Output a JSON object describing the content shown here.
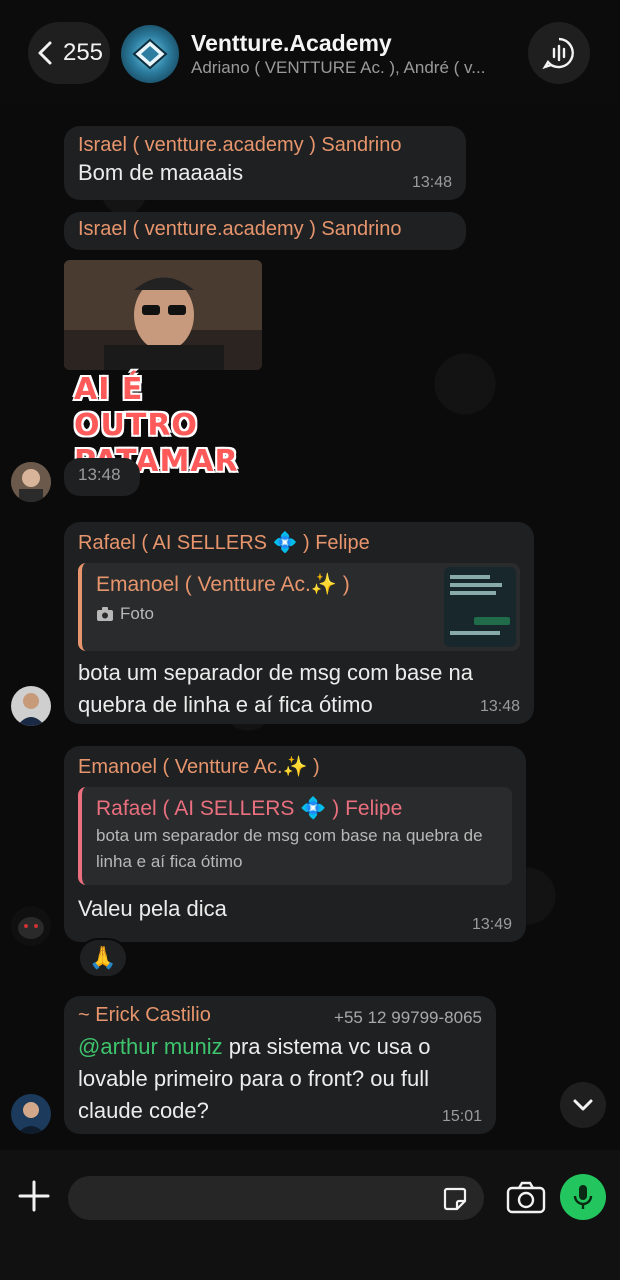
{
  "header": {
    "back_count": "255",
    "title": "Ventture.Academy",
    "subtitle": "Adriano ( VENTTURE Ac. ), André ( v..."
  },
  "messages": [
    {
      "sender": "Israel ( ventture.academy ) Sandrino",
      "text": "Bom de maaaais",
      "time": "13:48"
    },
    {
      "sender": "Israel ( ventture.academy ) Sandrino",
      "sticker_caption": "AI É OUTRO PATAMAR",
      "time": "13:48"
    },
    {
      "sender": "Rafael ( AI SELLERS 💠 ) Felipe",
      "quote_sender": "Emanoel ( Ventture Ac.✨ )",
      "quote_text": "Foto",
      "text": "bota um separador de msg com base na quebra de linha e aí fica ótimo",
      "time": "13:48"
    },
    {
      "sender": "Emanoel ( Ventture Ac.✨ )",
      "quote_sender": "Rafael ( AI SELLERS 💠 ) Felipe",
      "quote_text": "bota um separador de msg com base na quebra de linha e aí fica ótimo",
      "text": "Valeu pela dica",
      "time": "13:49",
      "reaction": "🙏"
    },
    {
      "sender": "~ Erick Castilio",
      "phone": "+55 12 99799-8065",
      "mention": "@arthur muniz",
      "text": " pra sistema vc usa o lovable primeiro para o front? ou full claude code?",
      "time": "15:01"
    }
  ],
  "colors": {
    "bubble": "#1f2021",
    "accent_green": "#23c55e",
    "sender_orange": "#e6956d",
    "sender_pink": "#ea6f7f"
  }
}
